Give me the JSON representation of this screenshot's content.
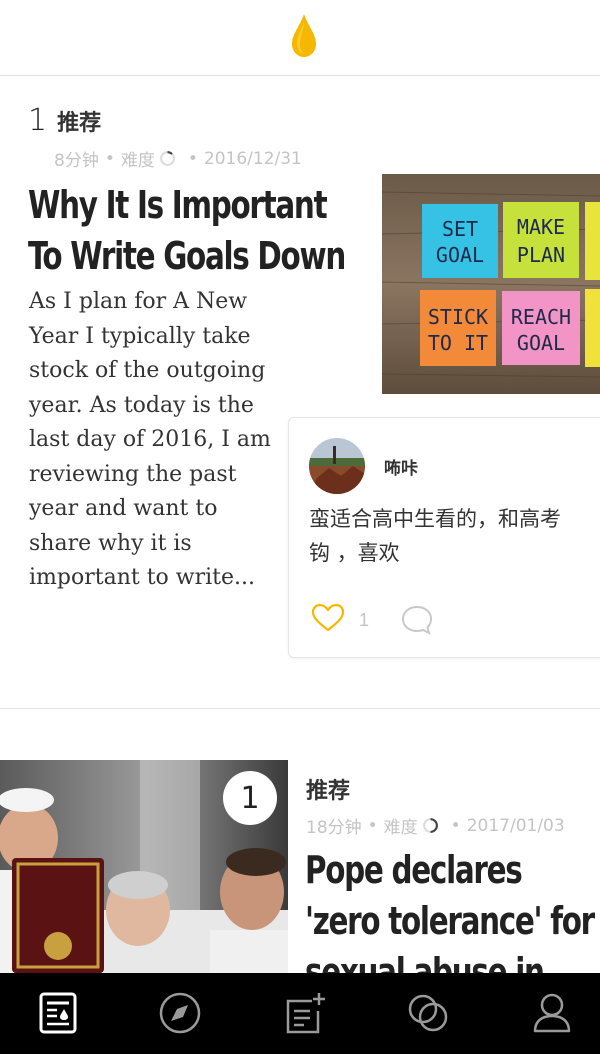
{
  "featured": {
    "rank": "1",
    "tag": "推荐",
    "meta": {
      "duration": "8分钟",
      "difficulty_label": "难度",
      "date": "2016/12/31",
      "separator": "•"
    },
    "title": "Why It Is Important To Write Goals Down",
    "excerpt": "As I plan for A New Year I typically take stock of the outgoing year. As today is the last day of 2016, I am reviewing the past year and want to share why it is important to write...",
    "image": {
      "notes": [
        {
          "text": "SET GOAL",
          "color": "#35c2e4"
        },
        {
          "text": "MAKE PLAN",
          "color": "#c6e13c"
        },
        {
          "text": "STICK TO IT",
          "color": "#f28a3a"
        },
        {
          "text": "REACH GOAL",
          "color": "#f394c6"
        }
      ]
    },
    "comment": {
      "user": "咘咔",
      "text": "蛮适合高中生看的，和高考\n钩 ，喜欢",
      "like_count": "1"
    }
  },
  "second": {
    "rank": "1",
    "tag": "推荐",
    "meta": {
      "duration": "18分钟",
      "difficulty_label": "难度",
      "date": "2017/01/03",
      "separator": "•"
    },
    "title": "Pope declares 'zero tolerance' for sexual abuse in"
  },
  "colors": {
    "accent": "#f5b700",
    "meta": "#c4c4c4",
    "tabbar": "#000000",
    "tab_icon": "#9a9a9a",
    "tab_active": "#ffffff"
  },
  "tabs": [
    {
      "icon": "reading-icon",
      "active": true
    },
    {
      "icon": "compass-icon",
      "active": false
    },
    {
      "icon": "notes-add-icon",
      "active": false
    },
    {
      "icon": "circles-icon",
      "active": false
    },
    {
      "icon": "profile-icon",
      "active": false
    }
  ]
}
